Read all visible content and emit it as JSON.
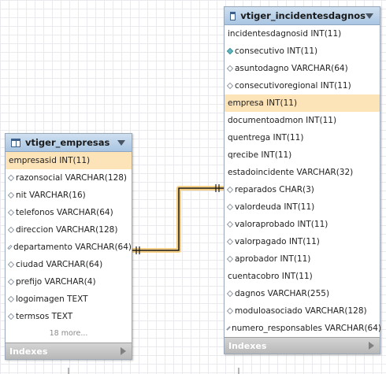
{
  "tables": {
    "empresas": {
      "name": "vtiger_empresas",
      "rows": [
        {
          "text": "empresasid INT(11)",
          "key": true
        },
        {
          "text": "razonsocial VARCHAR(128)"
        },
        {
          "text": "nit VARCHAR(16)"
        },
        {
          "text": "telefonos VARCHAR(64)"
        },
        {
          "text": "direccion VARCHAR(128)"
        },
        {
          "text": "departamento VARCHAR(64)"
        },
        {
          "text": "ciudad VARCHAR(64)"
        },
        {
          "text": "prefijo VARCHAR(4)"
        },
        {
          "text": "logoimagen TEXT"
        },
        {
          "text": "termsos TEXT"
        }
      ],
      "more": "18 more...",
      "footer": "Indexes"
    },
    "incidentes": {
      "name": "vtiger_incidentesdagnos",
      "rows": [
        {
          "text": "incidentesdagnosid INT(11)",
          "icon": "none"
        },
        {
          "text": "consecutivo INT(11)",
          "icon": "filled"
        },
        {
          "text": "asuntodagno VARCHAR(64)",
          "icon": "open"
        },
        {
          "text": "consecutivoregional INT(11)",
          "icon": "open"
        },
        {
          "text": "empresa INT(11)",
          "icon": "none",
          "key": true
        },
        {
          "text": "documentoadmon INT(11)",
          "icon": "none"
        },
        {
          "text": "quentrega INT(11)",
          "icon": "none"
        },
        {
          "text": "qrecibe INT(11)",
          "icon": "none"
        },
        {
          "text": "estadoincidente VARCHAR(32)",
          "icon": "none"
        },
        {
          "text": "reparados CHAR(3)",
          "icon": "open"
        },
        {
          "text": "valordeuda INT(11)",
          "icon": "open"
        },
        {
          "text": "valoraprobado INT(11)",
          "icon": "open"
        },
        {
          "text": "valorpagado INT(11)",
          "icon": "open"
        },
        {
          "text": "aprobador INT(11)",
          "icon": "open"
        },
        {
          "text": "cuentacobro INT(11)",
          "icon": "none"
        },
        {
          "text": "dagnos VARCHAR(255)",
          "icon": "open"
        },
        {
          "text": "moduloasociado VARCHAR(128)",
          "icon": "open"
        },
        {
          "text": "numero_responsables VARCHAR(64)",
          "icon": "open"
        }
      ],
      "footer": "Indexes"
    }
  },
  "colors": {
    "relationship": "#e8a33a",
    "key_row": "#fde3b8",
    "header": "#a9c5e2"
  },
  "icons": [
    "table-icon",
    "chevron-down-icon",
    "column-diamond-icon",
    "column-filled-diamond-icon",
    "indexes-arrow-icon"
  ]
}
